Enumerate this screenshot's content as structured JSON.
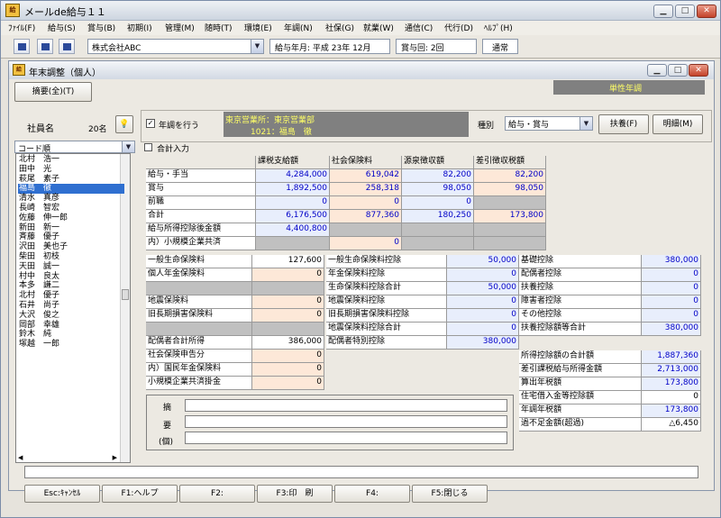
{
  "window": {
    "title": "メールde給与１１"
  },
  "menu": [
    "ﾌｧｲﾙ(F)",
    "給与(S)",
    "賞与(B)",
    "初期(I)",
    "管理(M)",
    "随時(T)",
    "環境(E)",
    "年調(N)",
    "社保(G)",
    "就業(W)",
    "通信(C)",
    "代行(D)",
    "ﾍﾙﾌﾟ(H)"
  ],
  "toolbar": {
    "company": "株式会社ABC",
    "pay_month": "給与年月: 平成 23年 12月",
    "bonus_count": "賞与回: 2回",
    "mode": "通常"
  },
  "inner": {
    "title": "年末調整（個人）",
    "status": "単性年調",
    "summary_button": "摘要(全)(T)"
  },
  "employees": {
    "label": "社員名",
    "count": "20名",
    "sort": "コード順",
    "names": [
      "北村　浩一",
      "田中　光",
      "萩尾　素子",
      "福島　徹",
      "清水　真彦",
      "長崎　智宏",
      "佐藤　伸一郎",
      "新田　新一",
      "斉藤　優子",
      "沢田　美也子",
      "柴田　初枝",
      "天田　誠一",
      "村中　良太",
      "本多　謙二",
      "北村　優子",
      "石井　尚子",
      "大沢　俊之",
      "岡部　幸雄",
      "鈴木　純",
      "塚越　一郎"
    ],
    "selected": 3
  },
  "header": {
    "adjust_label": "年調を行う",
    "office": "東京営業所：東京営業部",
    "employee": "1021：福島　徹",
    "type_label": "種別",
    "type_value": "給与・賞与",
    "dependents_button": "扶養(F)",
    "details_button": "明細(M)",
    "total_input": "合計入力"
  },
  "income_table": {
    "cols": [
      "課税支給額",
      "社会保険料",
      "源泉徴収額",
      "差引徴収税額"
    ],
    "rows": [
      {
        "label": "給与・手当",
        "vals": [
          "4,284,000",
          "619,042",
          "82,200",
          "82,200"
        ]
      },
      {
        "label": "賞与",
        "vals": [
          "1,892,500",
          "258,318",
          "98,050",
          "98,050"
        ]
      },
      {
        "label": "前職",
        "vals": [
          "0",
          "0",
          "0",
          ""
        ]
      },
      {
        "label": "合計",
        "vals": [
          "6,176,500",
          "877,360",
          "180,250",
          "173,800"
        ]
      },
      {
        "label": "給与所得控除後金額",
        "vals": [
          "4,400,800",
          "",
          "",
          ""
        ]
      },
      {
        "label": "内）小規模企業共済",
        "vals": [
          "",
          "0",
          "",
          ""
        ]
      }
    ]
  },
  "ins_left": [
    {
      "label": "一般生命保険料",
      "val": "127,600"
    },
    {
      "label": "個人年金保険料",
      "val": "0"
    },
    {
      "label": "",
      "val": ""
    },
    {
      "label": "地震保険料",
      "val": "0"
    },
    {
      "label": "旧長期損害保険料",
      "val": "0"
    },
    {
      "label": "",
      "val": ""
    },
    {
      "label": "配偶者合計所得",
      "val": "386,000"
    },
    {
      "label": "社会保険申告分",
      "val": "0"
    },
    {
      "label": "内）国民年金保険料",
      "val": "0"
    },
    {
      "label": "小規模企業共済掛金",
      "val": "0"
    }
  ],
  "ins_mid": [
    {
      "label": "一般生命保険料控除",
      "val": "50,000"
    },
    {
      "label": "年金保険料控除",
      "val": "0"
    },
    {
      "label": "生命保険料控除合計",
      "val": "50,000"
    },
    {
      "label": "地震保険料控除",
      "val": "0"
    },
    {
      "label": "旧長期損害保険料控除",
      "val": "0"
    },
    {
      "label": "地震保険料控除合計",
      "val": "0"
    },
    {
      "label": "配偶者特別控除",
      "val": "380,000"
    }
  ],
  "deductions": [
    {
      "label": "基礎控除",
      "val": "380,000"
    },
    {
      "label": "配偶者控除",
      "val": "0"
    },
    {
      "label": "扶養控除",
      "val": "0"
    },
    {
      "label": "障害者控除",
      "val": "0"
    },
    {
      "label": "その他控除",
      "val": "0"
    },
    {
      "label": "扶養控除額等合計",
      "val": "380,000"
    }
  ],
  "results": [
    {
      "label": "所得控除額の合計額",
      "val": "1,887,360"
    },
    {
      "label": "差引課税給与所得金額",
      "val": "2,713,000"
    },
    {
      "label": "算出年税額",
      "val": "173,800"
    },
    {
      "label": "住宅借入金等控除額",
      "val": "0"
    },
    {
      "label": "年調年税額",
      "val": "173,800"
    },
    {
      "label": "過不足金額(超過)",
      "val": "△6,450"
    }
  ],
  "memo": {
    "label": [
      "摘",
      "要",
      "(個)"
    ]
  },
  "fkeys": [
    "Esc:ｷｬﾝｾﾙ",
    "F1:ヘルプ",
    "F2:",
    "F3:印　刷",
    "F4:",
    "F5:閉じる"
  ]
}
